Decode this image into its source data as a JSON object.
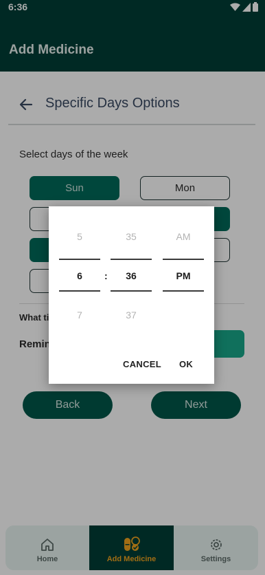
{
  "status_bar": {
    "time": "6:36",
    "icons": [
      "wifi-icon",
      "signal-icon",
      "battery-icon"
    ]
  },
  "app_bar": {
    "title": "Add Medicine"
  },
  "page": {
    "heading": "Specific Days Options",
    "select_label": "Select days of the week",
    "days": [
      {
        "label": "Sun",
        "selected": true
      },
      {
        "label": "Mon",
        "selected": false
      },
      {
        "label": "",
        "selected": false
      },
      {
        "label": "",
        "selected": true
      },
      {
        "label": "",
        "selected": true
      },
      {
        "label": "",
        "selected": false
      },
      {
        "label": "",
        "selected": false
      }
    ],
    "what_time_partial": "What ti",
    "reminder_partial": "Remin",
    "back_label": "Back",
    "next_label": "Next"
  },
  "time_picker": {
    "hour": {
      "prev": "5",
      "current": "6",
      "next": "7"
    },
    "separator": ":",
    "minute": {
      "prev": "35",
      "current": "36",
      "next": "37"
    },
    "period": {
      "prev": "AM",
      "current": "PM"
    },
    "cancel_label": "CANCEL",
    "ok_label": "OK"
  },
  "bottom_nav": {
    "items": [
      {
        "label": "Home",
        "icon": "home-icon"
      },
      {
        "label": "Add Medicine",
        "icon": "pill-icon"
      },
      {
        "label": "Settings",
        "icon": "gear-icon"
      }
    ]
  },
  "colors": {
    "primary_dark": "#003e36",
    "primary": "#006b5a",
    "accent": "#19a889",
    "active_nav_label": "#f0a31e"
  }
}
